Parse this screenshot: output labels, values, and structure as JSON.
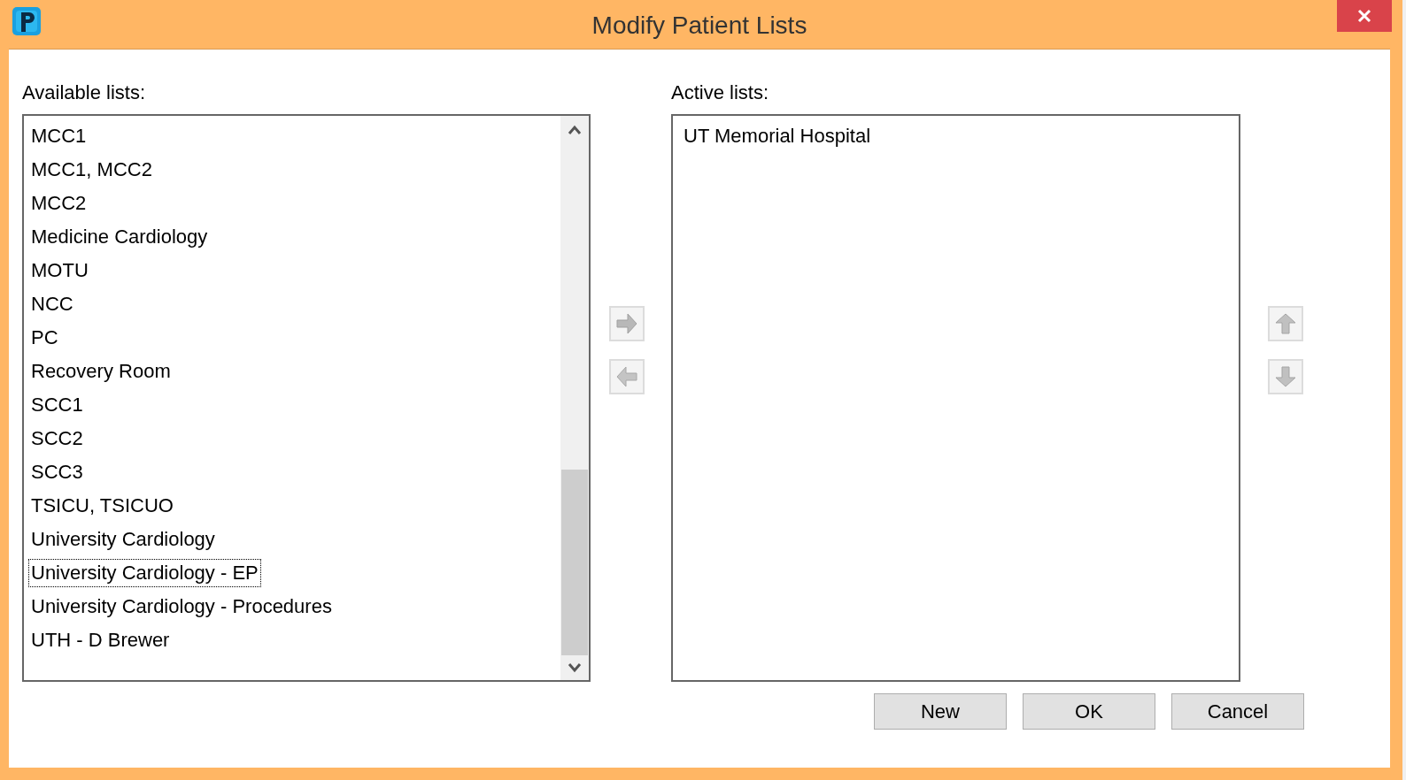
{
  "window": {
    "title": "Modify Patient Lists"
  },
  "available_lists": {
    "label": "Available lists:",
    "items": [
      {
        "label": "MCC1",
        "focused": false
      },
      {
        "label": "MCC1, MCC2",
        "focused": false
      },
      {
        "label": "MCC2",
        "focused": false
      },
      {
        "label": "Medicine Cardiology",
        "focused": false
      },
      {
        "label": "MOTU",
        "focused": false
      },
      {
        "label": "NCC",
        "focused": false
      },
      {
        "label": "PC",
        "focused": false
      },
      {
        "label": "Recovery Room",
        "focused": false
      },
      {
        "label": "SCC1",
        "focused": false
      },
      {
        "label": "SCC2",
        "focused": false
      },
      {
        "label": "SCC3",
        "focused": false
      },
      {
        "label": "TSICU, TSICUO",
        "focused": false
      },
      {
        "label": "University Cardiology",
        "focused": false
      },
      {
        "label": "University Cardiology - EP",
        "focused": true
      },
      {
        "label": "University Cardiology - Procedures",
        "focused": false
      },
      {
        "label": "UTH - D Brewer",
        "focused": false
      }
    ]
  },
  "active_lists": {
    "label": "Active lists:",
    "items": [
      {
        "label": "UT Memorial Hospital",
        "focused": false
      }
    ]
  },
  "buttons": [
    "New",
    "OK",
    "Cancel"
  ]
}
